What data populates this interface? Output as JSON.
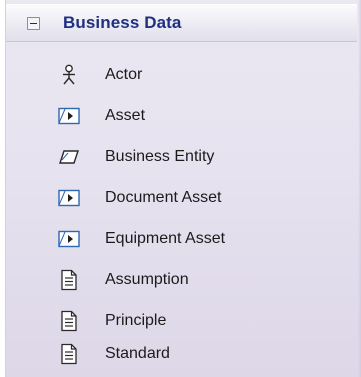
{
  "toolbox": {
    "group_title": "Business Data",
    "items": [
      {
        "label": "Actor",
        "icon": "actor-icon"
      },
      {
        "label": "Asset",
        "icon": "asset-icon"
      },
      {
        "label": "Business Entity",
        "icon": "business-entity-icon"
      },
      {
        "label": "Document Asset",
        "icon": "asset-icon"
      },
      {
        "label": "Equipment Asset",
        "icon": "asset-icon"
      },
      {
        "label": "Assumption",
        "icon": "document-icon"
      },
      {
        "label": "Principle",
        "icon": "document-icon"
      },
      {
        "label": "Standard",
        "icon": "document-icon"
      }
    ]
  },
  "colors": {
    "title": "#1f2f82",
    "icon_blue": "#2f67b3"
  }
}
